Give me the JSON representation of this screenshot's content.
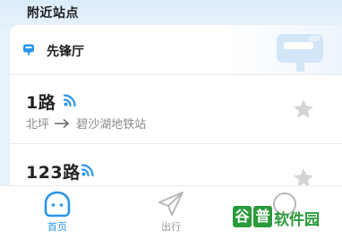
{
  "nearby": {
    "title": "附近站点"
  },
  "station": {
    "name": "先锋厅",
    "icon": "bus-stop-icon"
  },
  "routes": [
    {
      "number": "1路",
      "from": "北坪",
      "to": "碧沙湖地铁站",
      "live": true,
      "favorited": false
    },
    {
      "number": "123路",
      "live": true,
      "favorited": false
    }
  ],
  "tabbar": {
    "tabs": [
      {
        "label": "首页",
        "icon": "home-icon",
        "active": true
      },
      {
        "label": "出行",
        "icon": "paper-plane-icon",
        "active": false
      },
      {
        "label": "",
        "icon": "circle-icon",
        "active": false
      }
    ]
  },
  "watermark": {
    "char1": "谷",
    "char2": "普",
    "text": "软件园"
  },
  "colors": {
    "accent": "#2b95e9",
    "star": "#d4d4d4",
    "watermark": "#2a9a3a"
  }
}
